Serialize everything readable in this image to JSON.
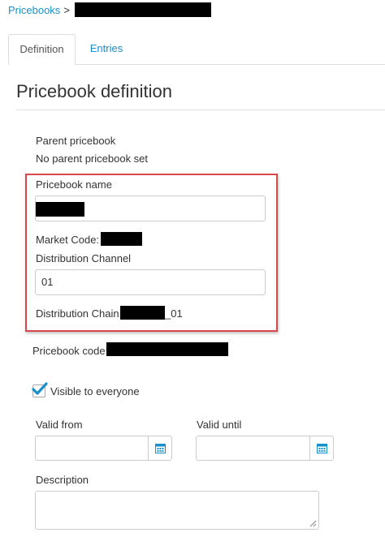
{
  "breadcrumb": {
    "root": "Pricebooks",
    "separator": ">"
  },
  "tabs": [
    {
      "label": "Definition",
      "active": true
    },
    {
      "label": "Entries",
      "active": false
    }
  ],
  "page_title": "Pricebook definition",
  "parent": {
    "label": "Parent pricebook",
    "value": "No parent pricebook set"
  },
  "form": {
    "pricebook_name_label": "Pricebook name",
    "pricebook_name_value": "",
    "market_code_label": "Market Code:",
    "distribution_channel_label": "Distribution Channel",
    "distribution_channel_value": "01",
    "distribution_chain_label": "Distribution Chain",
    "distribution_chain_suffix": "_01",
    "pricebook_code_label": "Pricebook code:",
    "visible_label": "Visible to everyone",
    "visible_checked": true,
    "valid_from_label": "Valid from",
    "valid_until_label": "Valid until",
    "description_label": "Description"
  },
  "icons": {
    "checkmark": "checkmark-icon",
    "calendar": "calendar-icon",
    "resize": "resize-handle-icon"
  },
  "colors": {
    "link": "#1a8fc9",
    "highlight": "#d9474a",
    "check": "#1a8fc9"
  }
}
